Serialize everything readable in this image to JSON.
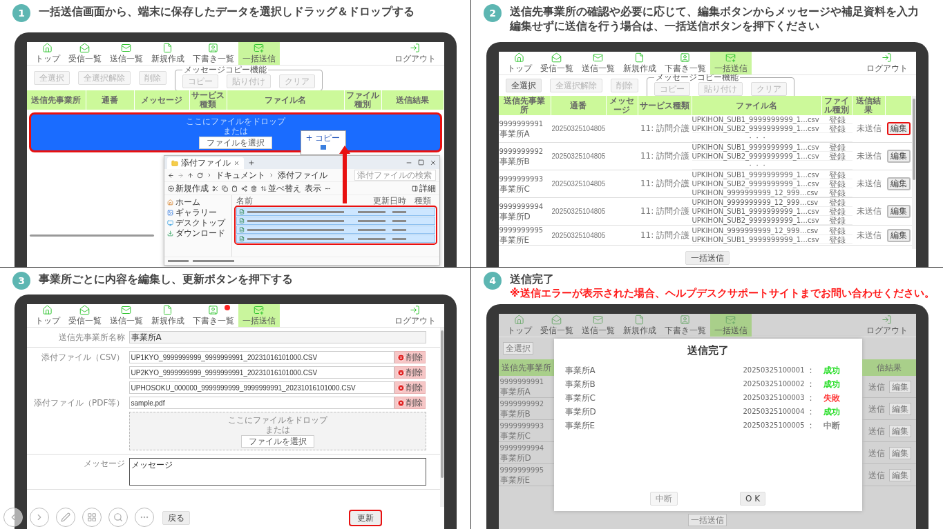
{
  "panels": [
    {
      "number": "1",
      "kind": "drop",
      "title": [
        {
          "text": "一括送信画面から、端末に保存したデータを選択しドラッグ＆ドロップする",
          "warning": false
        }
      ],
      "screen": {
        "nav": {
          "items": [
            {
              "label": "トップ",
              "selected": false,
              "notify": false
            },
            {
              "label": "受信一覧",
              "selected": false,
              "notify": false
            },
            {
              "label": "送信一覧",
              "selected": false,
              "notify": false
            },
            {
              "label": "新規作成",
              "selected": false,
              "notify": false
            },
            {
              "label": "下書き一覧",
              "selected": false,
              "notify": false
            },
            {
              "label": "一括送信",
              "selected": true,
              "notify": false
            }
          ],
          "logout": "ログアウト"
        },
        "toolbar": {
          "buttons": [
            {
              "label": "全選択",
              "disabled": true
            },
            {
              "label": "全選択解除",
              "disabled": true
            },
            {
              "label": "削除",
              "disabled": true
            }
          ],
          "copy_group": {
            "legend": "メッセージコピー機能",
            "buttons": [
              {
                "label": "コピー",
                "disabled": true
              },
              {
                "label": "貼り付け",
                "disabled": true
              },
              {
                "label": "クリア",
                "disabled": true
              }
            ]
          }
        },
        "columns": [
          "送信先事業所",
          "通番",
          "メッセージ",
          "サービス種類",
          "ファイル名",
          "ファイル種別",
          "送信結果"
        ],
        "dropzone": {
          "text": "ここにファイルをドロップ",
          "or": "または",
          "button": "ファイルを選択",
          "drag_over": true,
          "highlighted": true
        },
        "drag_tooltip": "+ コピー",
        "explorer": {
          "title": "添付ファイル",
          "path": [
            "ドキュメント",
            "添付ファイル"
          ],
          "search_placeholder": "添付ファイルの検索",
          "new_button": "新規作成",
          "sort_button": "並べ替え",
          "view_button": "表示",
          "details_button": "詳細",
          "sidebar": [
            "ホーム",
            "ギャラリー",
            "デスクトップ",
            "ダウンロード"
          ],
          "columns": [
            "名前",
            "更新日時",
            "種類"
          ],
          "highlighted": true,
          "files": [
            {
              "selected": true
            },
            {
              "selected": true
            },
            {
              "selected": true
            },
            {
              "selected": true
            }
          ]
        }
      }
    },
    {
      "number": "2",
      "kind": "list",
      "title": [
        {
          "text": "送信先事業所の確認や必要に応じて、編集ボタンからメッセージや補足資料を入力",
          "warning": false
        },
        {
          "text": "編集せずに送信を行う場合は、一括送信ボタンを押下ください",
          "warning": false
        }
      ],
      "screen": {
        "nav": {
          "items": [
            {
              "label": "トップ",
              "selected": false,
              "notify": false
            },
            {
              "label": "受信一覧",
              "selected": false,
              "notify": false
            },
            {
              "label": "送信一覧",
              "selected": false,
              "notify": false
            },
            {
              "label": "新規作成",
              "selected": false,
              "notify": false
            },
            {
              "label": "下書き一覧",
              "selected": false,
              "notify": false
            },
            {
              "label": "一括送信",
              "selected": true,
              "notify": false
            }
          ],
          "logout": "ログアウト"
        },
        "toolbar": {
          "buttons": [
            {
              "label": "全選択",
              "disabled": false
            },
            {
              "label": "全選択解除",
              "disabled": true
            },
            {
              "label": "削除",
              "disabled": true
            }
          ],
          "copy_group": {
            "legend": "メッセージコピー機能",
            "buttons": [
              {
                "label": "コピー",
                "disabled": true
              },
              {
                "label": "貼り付け",
                "disabled": true
              },
              {
                "label": "クリア",
                "disabled": true
              }
            ]
          }
        },
        "columns": [
          "送信先事業所",
          "通番",
          "メッセージ",
          "サービス種類",
          "ファイル名",
          "ファイル種別",
          "送信結果"
        ],
        "rows": [
          {
            "office_id": "9999999991",
            "office_name": "事業所A",
            "serial": "20250325104805",
            "service": "11: 訪問介護",
            "files": [
              {
                "name": "UPKIHON_SUB1_9999999999_1…csv",
                "type": "登録"
              },
              {
                "name": "UPKIHON_SUB2_9999999999_1…csv",
                "type": "登録"
              }
            ],
            "more": "・・・",
            "result": "未送信",
            "action": "編集",
            "highlighted": true
          },
          {
            "office_id": "9999999992",
            "office_name": "事業所B",
            "serial": "20250325104805",
            "service": "11: 訪問介護",
            "files": [
              {
                "name": "UPKIHON_SUB1_9999999999_1…csv",
                "type": "登録"
              },
              {
                "name": "UPKIHON_SUB2_9999999999_1…csv",
                "type": "登録"
              }
            ],
            "more": "・・・",
            "result": "未送信",
            "action": "編集",
            "highlighted": false
          },
          {
            "office_id": "9999999993",
            "office_name": "事業所C",
            "serial": "20250325104805",
            "service": "11: 訪問介護",
            "files": [
              {
                "name": "UPKIHON_SUB1_9999999999_1…csv",
                "type": "登録"
              },
              {
                "name": "UPKIHON_SUB2_9999999999_1…csv",
                "type": "登録"
              },
              {
                "name": "UPKIHON_9999999999_12_999…csv",
                "type": "登録"
              }
            ],
            "result": "未送信",
            "action": "編集",
            "highlighted": false
          },
          {
            "office_id": "9999999994",
            "office_name": "事業所D",
            "serial": "20250325104805",
            "service": "11: 訪問介護",
            "files": [
              {
                "name": "UPKIHON_9999999999_12_999…csv",
                "type": "登録"
              },
              {
                "name": "UPKIHON_SUB1_9999999999_1…csv",
                "type": "登録"
              },
              {
                "name": "UPKIHON_SUB2_9999999999_1…csv",
                "type": "登録"
              }
            ],
            "result": "未送信",
            "action": "編集",
            "highlighted": false
          },
          {
            "office_id": "9999999995",
            "office_name": "事業所E",
            "serial": "20250325104805",
            "service": "11: 訪問介護",
            "files": [
              {
                "name": "UPKIHON_9999999999_12_999…csv",
                "type": "登録"
              },
              {
                "name": "UPKIHON_SUB1_9999999999_1…csv",
                "type": "登録"
              }
            ],
            "result": "未送信",
            "action": "編集",
            "highlighted": false
          }
        ],
        "submit": "一括送信"
      }
    },
    {
      "number": "3",
      "kind": "edit",
      "title": [
        {
          "text": "事業所ごとに内容を編集し、更新ボタンを押下する",
          "warning": false
        }
      ],
      "screen": {
        "nav": {
          "items": [
            {
              "label": "トップ",
              "selected": false,
              "notify": false
            },
            {
              "label": "受信一覧",
              "selected": false,
              "notify": false
            },
            {
              "label": "送信一覧",
              "selected": false,
              "notify": false
            },
            {
              "label": "新規作成",
              "selected": false,
              "notify": false
            },
            {
              "label": "下書き一覧",
              "selected": false,
              "notify": true
            },
            {
              "label": "一括送信",
              "selected": true,
              "notify": false
            }
          ],
          "logout": "ログアウト"
        },
        "office_label": "送信先事業所名称",
        "office_value": "事業所A",
        "csv_label": "添付ファイル（CSV）",
        "csv_files": [
          {
            "name": "UP1KYO_9999999999_9999999991_20231016101000.CSV",
            "delete": "削除"
          },
          {
            "name": "UP2KYO_9999999999_9999999991_20231016101000.CSV",
            "delete": "削除"
          },
          {
            "name": "UPHOSOKU_000000_9999999999_9999999991_20231016101000.CSV",
            "delete": "削除"
          }
        ],
        "pdf_label": "添付ファイル（PDF等）",
        "pdf_files": [
          {
            "name": "sample.pdf",
            "delete": "削除"
          }
        ],
        "dropzone": {
          "text": "ここにファイルをドロップ",
          "or": "または",
          "button": "ファイルを選択"
        },
        "message_label": "メッセージ",
        "message_value": "メッセージ",
        "back": "戻る",
        "update": {
          "label": "更新",
          "highlighted": true
        }
      }
    },
    {
      "number": "4",
      "kind": "complete",
      "title": [
        {
          "text": "送信完了",
          "warning": false
        },
        {
          "text": "※送信エラーが表示された場合、ヘルプデスクサポートサイトまでお問い合わせください。",
          "warning": true
        }
      ],
      "screen": {
        "nav": {
          "items": [
            {
              "label": "トップ",
              "selected": false,
              "notify": false
            },
            {
              "label": "受信一覧",
              "selected": false,
              "notify": false
            },
            {
              "label": "送信一覧",
              "selected": false,
              "notify": false
            },
            {
              "label": "新規作成",
              "selected": false,
              "notify": false
            },
            {
              "label": "下書き一覧",
              "selected": false,
              "notify": false
            },
            {
              "label": "一括送信",
              "selected": true,
              "notify": false
            }
          ],
          "logout": "ログアウト"
        },
        "select_all": "全選択",
        "header_left": "送信先事業所",
        "header_right": "信結果",
        "rows": [
          {
            "office_id": "9999999991",
            "office_name": "事業所A",
            "result": "送信",
            "action": "編集"
          },
          {
            "office_id": "9999999992",
            "office_name": "事業所B",
            "result": "送信",
            "action": "編集"
          },
          {
            "office_id": "9999999993",
            "office_name": "事業所C",
            "result": "送信",
            "action": "編集"
          },
          {
            "office_id": "9999999994",
            "office_name": "事業所D",
            "result": "送信",
            "action": "編集"
          },
          {
            "office_id": "9999999995",
            "office_name": "事業所E",
            "result": "送信",
            "action": "編集"
          }
        ],
        "submit": "一括送信",
        "modal": {
          "title": "送信完了",
          "results": [
            {
              "office": "事業所A",
              "serial": "20250325100001",
              "separator": ":",
              "status": "成功",
              "color": "#22dd22"
            },
            {
              "office": "事業所B",
              "serial": "20250325100002",
              "separator": ":",
              "status": "成功",
              "color": "#22dd22"
            },
            {
              "office": "事業所C",
              "serial": "20250325100003",
              "separator": ":",
              "status": "失敗",
              "color": "#ff3333"
            },
            {
              "office": "事業所D",
              "serial": "20250325100004",
              "separator": ":",
              "status": "成功",
              "color": "#22dd22"
            },
            {
              "office": "事業所E",
              "serial": "20250325100005",
              "separator": ":",
              "status": "中断",
              "color": "#888888"
            }
          ],
          "cancel": {
            "label": "中断",
            "disabled": true
          },
          "ok": "O K"
        }
      }
    }
  ]
}
